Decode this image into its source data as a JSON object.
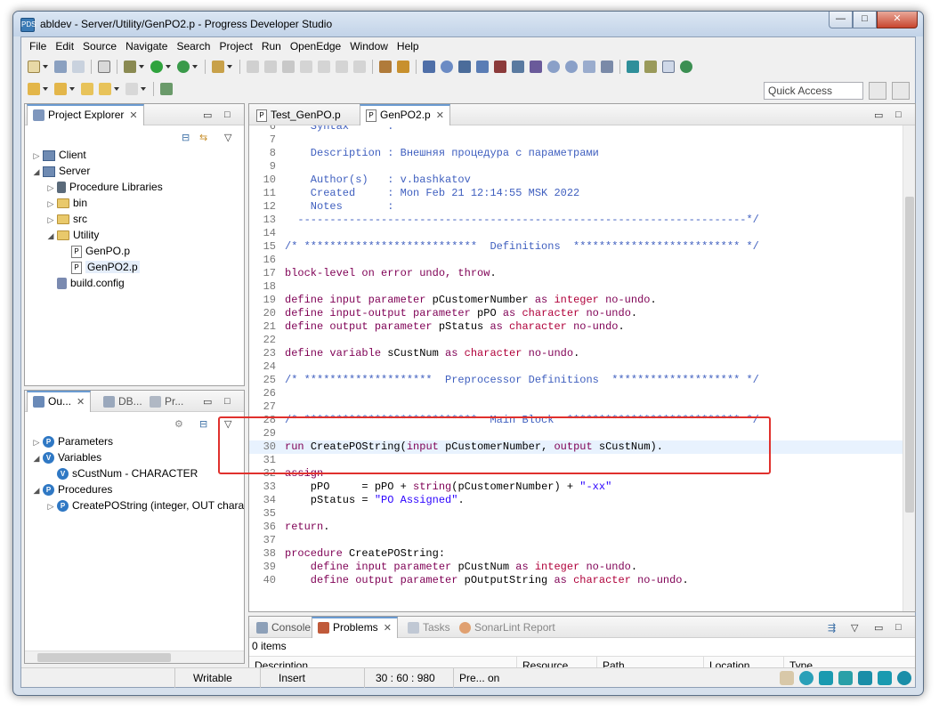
{
  "window": {
    "title": "abldev - Server/Utility/GenPO2.p - Progress Developer Studio",
    "minimize": "—",
    "maximize": "□",
    "close": "✕"
  },
  "menubar": [
    "File",
    "Edit",
    "Source",
    "Navigate",
    "Search",
    "Project",
    "Run",
    "OpenEdge",
    "Window",
    "Help"
  ],
  "quick_access": "Quick Access",
  "project_explorer": {
    "title": "Project Explorer",
    "items": [
      {
        "label": "Client",
        "depth": 0,
        "arrow": "▷",
        "icon": "project-icon"
      },
      {
        "label": "Server",
        "depth": 0,
        "arrow": "◢",
        "icon": "project-icon"
      },
      {
        "label": "Procedure Libraries",
        "depth": 1,
        "arrow": "▷",
        "icon": "library-icon"
      },
      {
        "label": "bin",
        "depth": 1,
        "arrow": "▷",
        "icon": "folder-icon"
      },
      {
        "label": "src",
        "depth": 1,
        "arrow": "▷",
        "icon": "folder-icon"
      },
      {
        "label": "Utility",
        "depth": 1,
        "arrow": "◢",
        "icon": "folder-icon"
      },
      {
        "label": "GenPO.p",
        "depth": 2,
        "arrow": "",
        "icon": "procedure-file-icon"
      },
      {
        "label": "GenPO2.p",
        "depth": 2,
        "arrow": "",
        "icon": "procedure-file-icon"
      },
      {
        "label": "build.config",
        "depth": 1,
        "arrow": "",
        "icon": "config-file-icon"
      }
    ]
  },
  "outline": {
    "tabs": [
      "Ou...",
      "DB...",
      "Pr..."
    ],
    "items": [
      {
        "label": "Parameters",
        "depth": 0,
        "arrow": "▷",
        "letter": "P"
      },
      {
        "label": "Variables",
        "depth": 0,
        "arrow": "◢",
        "letter": "V"
      },
      {
        "label": "sCustNum - CHARACTER",
        "depth": 1,
        "arrow": "",
        "letter": "V"
      },
      {
        "label": "Procedures",
        "depth": 0,
        "arrow": "◢",
        "letter": "P"
      },
      {
        "label": "CreatePOString (integer, OUT characte",
        "depth": 1,
        "arrow": "▷",
        "letter": "P"
      }
    ]
  },
  "editor_tabs": [
    "Test_GenPO.p",
    "GenPO2.p"
  ],
  "code_lines": [
    {
      "n": "6",
      "parts": [
        [
          "cm",
          "    Syntax      :"
        ]
      ]
    },
    {
      "n": "7",
      "parts": [
        [
          "cm",
          ""
        ]
      ]
    },
    {
      "n": "8",
      "parts": [
        [
          "cm",
          "    Description : Внешняя процедура с параметрами"
        ]
      ]
    },
    {
      "n": "9",
      "parts": [
        [
          "cm",
          ""
        ]
      ]
    },
    {
      "n": "10",
      "parts": [
        [
          "cm",
          "    Author(s)   : v.bashkatov"
        ]
      ]
    },
    {
      "n": "11",
      "parts": [
        [
          "cm",
          "    Created     : Mon Feb 21 12:14:55 MSK 2022"
        ]
      ]
    },
    {
      "n": "12",
      "parts": [
        [
          "cm",
          "    Notes       :"
        ]
      ]
    },
    {
      "n": "13",
      "parts": [
        [
          "cm",
          "  ----------------------------------------------------------------------*/"
        ]
      ]
    },
    {
      "n": "14",
      "parts": [
        [
          "tx",
          ""
        ]
      ]
    },
    {
      "n": "15",
      "parts": [
        [
          "cm",
          "/* ***************************  Definitions  ************************** */"
        ]
      ]
    },
    {
      "n": "16",
      "parts": [
        [
          "tx",
          ""
        ]
      ]
    },
    {
      "n": "17",
      "parts": [
        [
          "kw",
          "block-level on error undo, throw"
        ],
        [
          "tx",
          "."
        ]
      ]
    },
    {
      "n": "18",
      "parts": [
        [
          "tx",
          ""
        ]
      ]
    },
    {
      "n": "19",
      "parts": [
        [
          "kw",
          "define input parameter "
        ],
        [
          "tx",
          "pCustomerNumber "
        ],
        [
          "kw",
          "as "
        ],
        [
          "ty",
          "integer "
        ],
        [
          "kw",
          "no-undo"
        ],
        [
          "tx",
          "."
        ]
      ]
    },
    {
      "n": "20",
      "parts": [
        [
          "kw",
          "define input-output parameter "
        ],
        [
          "tx",
          "pPO "
        ],
        [
          "kw",
          "as "
        ],
        [
          "ty",
          "character "
        ],
        [
          "kw",
          "no-undo"
        ],
        [
          "tx",
          "."
        ]
      ]
    },
    {
      "n": "21",
      "parts": [
        [
          "kw",
          "define output parameter "
        ],
        [
          "tx",
          "pStatus "
        ],
        [
          "kw",
          "as "
        ],
        [
          "ty",
          "character "
        ],
        [
          "kw",
          "no-undo"
        ],
        [
          "tx",
          "."
        ]
      ]
    },
    {
      "n": "22",
      "parts": [
        [
          "tx",
          ""
        ]
      ]
    },
    {
      "n": "23",
      "parts": [
        [
          "kw",
          "define variable "
        ],
        [
          "tx",
          "sCustNum "
        ],
        [
          "kw",
          "as "
        ],
        [
          "ty",
          "character "
        ],
        [
          "kw",
          "no-undo"
        ],
        [
          "tx",
          "."
        ]
      ]
    },
    {
      "n": "24",
      "parts": [
        [
          "tx",
          ""
        ]
      ]
    },
    {
      "n": "25",
      "parts": [
        [
          "cm",
          "/* ********************  Preprocessor Definitions  ******************** */"
        ]
      ]
    },
    {
      "n": "26",
      "parts": [
        [
          "tx",
          ""
        ]
      ]
    },
    {
      "n": "27",
      "parts": [
        [
          "tx",
          ""
        ]
      ]
    },
    {
      "n": "28",
      "parts": [
        [
          "cm",
          "/* ***************************  Main Block  *************************** */"
        ]
      ]
    },
    {
      "n": "29",
      "parts": [
        [
          "tx",
          ""
        ]
      ]
    },
    {
      "n": "30",
      "parts": [
        [
          "kw",
          "run "
        ],
        [
          "tx",
          "CreatePOString("
        ],
        [
          "kw",
          "input "
        ],
        [
          "tx",
          "pCustomerNumber, "
        ],
        [
          "kw",
          "output "
        ],
        [
          "tx",
          "sCustNum)."
        ]
      ]
    },
    {
      "n": "31",
      "parts": [
        [
          "tx",
          ""
        ]
      ]
    },
    {
      "n": "32",
      "parts": [
        [
          "kw",
          "assign"
        ]
      ]
    },
    {
      "n": "33",
      "parts": [
        [
          "tx",
          "    pPO     = pPO + "
        ],
        [
          "kw",
          "string"
        ],
        [
          "tx",
          "(pCustomerNumber) + "
        ],
        [
          "st",
          "\"-xx\""
        ]
      ]
    },
    {
      "n": "34",
      "parts": [
        [
          "tx",
          "    pStatus = "
        ],
        [
          "st",
          "\"PO Assigned\""
        ],
        [
          "tx",
          "."
        ]
      ]
    },
    {
      "n": "35",
      "parts": [
        [
          "tx",
          ""
        ]
      ]
    },
    {
      "n": "36",
      "parts": [
        [
          "kw",
          "return"
        ],
        [
          "tx",
          "."
        ]
      ]
    },
    {
      "n": "37",
      "parts": [
        [
          "tx",
          ""
        ]
      ]
    },
    {
      "n": "38",
      "parts": [
        [
          "kw",
          "procedure "
        ],
        [
          "tx",
          "CreatePOString:"
        ]
      ]
    },
    {
      "n": "39",
      "parts": [
        [
          "kw",
          "    define input parameter "
        ],
        [
          "tx",
          "pCustNum "
        ],
        [
          "kw",
          "as "
        ],
        [
          "ty",
          "integer "
        ],
        [
          "kw",
          "no-undo"
        ],
        [
          "tx",
          "."
        ]
      ]
    },
    {
      "n": "40",
      "parts": [
        [
          "kw",
          "    define output parameter "
        ],
        [
          "tx",
          "pOutputString "
        ],
        [
          "kw",
          "as "
        ],
        [
          "ty",
          "character "
        ],
        [
          "kw",
          "no-undo"
        ],
        [
          "tx",
          "."
        ]
      ]
    }
  ],
  "bottom_panel": {
    "tabs": [
      "Console",
      "Problems",
      "Tasks",
      "SonarLint Report"
    ],
    "count": "0 items",
    "columns": [
      "Description",
      "Resource",
      "Path",
      "Location",
      "Type"
    ]
  },
  "statusbar": {
    "writable": "Writable",
    "insert": "Insert",
    "position": "30 : 60 : 980",
    "pre": "Pre... on"
  },
  "colors": {
    "highlight": "#e0312d",
    "keyword": "#7f0055",
    "type": "#b0003a",
    "comment": "#3f5fbf",
    "string": "#2a00ff"
  }
}
